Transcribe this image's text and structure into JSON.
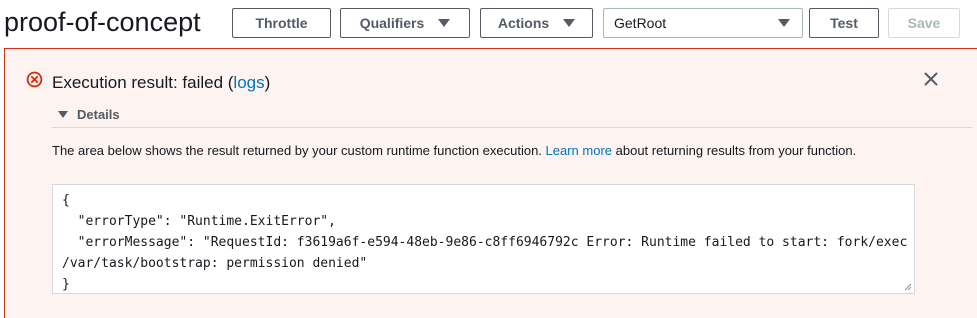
{
  "header": {
    "title": "proof-of-concept",
    "throttle_label": "Throttle",
    "qualifiers_label": "Qualifiers",
    "actions_label": "Actions",
    "test_event_selected": "GetRoot",
    "test_label": "Test",
    "save_label": "Save"
  },
  "result": {
    "title_prefix": "Execution result: failed (",
    "logs_link": "logs",
    "title_suffix": ")",
    "details_label": "Details",
    "description_text": "The area below shows the result returned by your custom runtime function execution. ",
    "learn_more_link": "Learn more",
    "description_suffix": " about returning results from your function.",
    "output": "{\n  \"errorType\": \"Runtime.ExitError\",\n  \"errorMessage\": \"RequestId: f3619a6f-e594-48eb-9e86-c8ff6946792c Error: Runtime failed to start: fork/exec\n/var/task/bootstrap: permission denied\"\n}"
  },
  "colors": {
    "error": "#d13212",
    "panel_bg": "#fdf3f1",
    "link": "#0073bb"
  },
  "icons": {
    "error": "error-circle-x-icon",
    "close": "close-x-icon",
    "dropdown": "caret-down-icon"
  }
}
